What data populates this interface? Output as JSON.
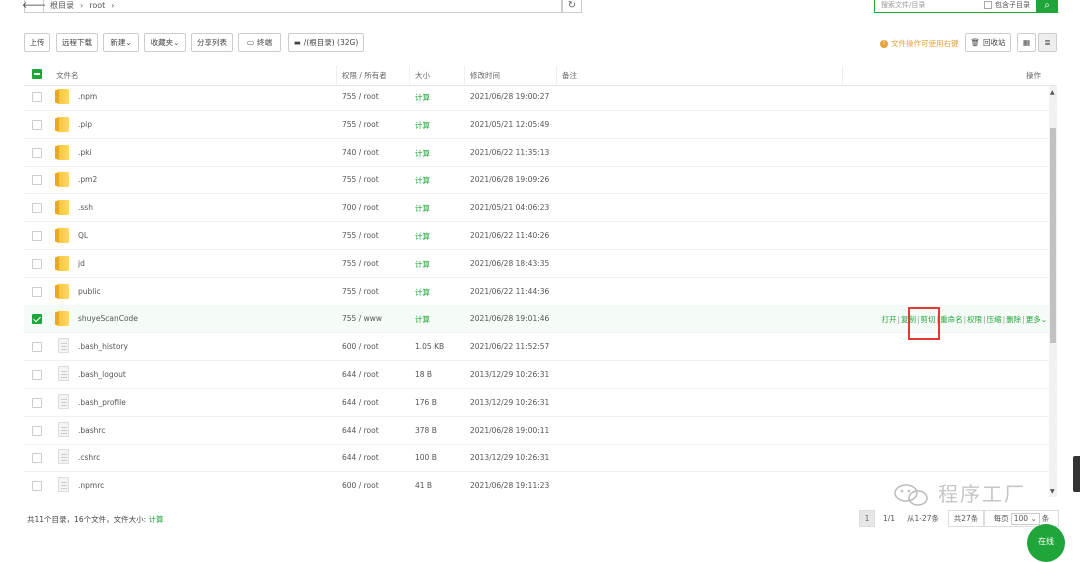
{
  "path": {
    "back_icon": "arrow-left-icon",
    "crumbs": [
      "根目录",
      "root"
    ],
    "refresh_icon": "refresh-icon"
  },
  "search": {
    "placeholder": "搜索文件/目录",
    "include_sub_label": "包含子目录",
    "button_icon": "search-icon"
  },
  "toolbar": {
    "upload": "上传",
    "remote_download": "远程下载",
    "new": "新建",
    "favorites": "收藏夹",
    "share_list": "分享列表",
    "terminal": "终端",
    "disk": "/(根目录) (32G)",
    "warn_text": "文件操作可使用右键",
    "recycle": "回收站"
  },
  "columns": {
    "name": "文件名",
    "perm": "权限 / 所有者",
    "size": "大小",
    "mtime": "修改时间",
    "remark": "备注",
    "ops": "操作"
  },
  "rows": [
    {
      "name": ".npm",
      "type": "folder",
      "perm": "755 / root",
      "size": "计算",
      "mtime": "2021/06/28 19:00:27"
    },
    {
      "name": ".pip",
      "type": "folder",
      "perm": "755 / root",
      "size": "计算",
      "mtime": "2021/05/21 12:05:49"
    },
    {
      "name": ".pki",
      "type": "folder",
      "perm": "740 / root",
      "size": "计算",
      "mtime": "2021/06/22 11:35:13"
    },
    {
      "name": ".pm2",
      "type": "folder",
      "perm": "755 / root",
      "size": "计算",
      "mtime": "2021/06/28 19:09:26"
    },
    {
      "name": ".ssh",
      "type": "folder",
      "perm": "700 / root",
      "size": "计算",
      "mtime": "2021/05/21 04:06:23"
    },
    {
      "name": "QL",
      "type": "folder",
      "perm": "755 / root",
      "size": "计算",
      "mtime": "2021/06/22 11:40:26"
    },
    {
      "name": "jd",
      "type": "folder",
      "perm": "755 / root",
      "size": "计算",
      "mtime": "2021/06/28 18:43:35"
    },
    {
      "name": "public",
      "type": "folder",
      "perm": "755 / root",
      "size": "计算",
      "mtime": "2021/06/22 11:44:36"
    },
    {
      "name": "shuyeScanCode",
      "type": "folder",
      "perm": "755 / www",
      "size": "计算",
      "mtime": "2021/06/28 19:01:46",
      "selected": true
    },
    {
      "name": ".bash_history",
      "type": "file",
      "perm": "600 / root",
      "size": "1.05 KB",
      "mtime": "2021/06/22 11:52:57"
    },
    {
      "name": ".bash_logout",
      "type": "file",
      "perm": "644 / root",
      "size": "18 B",
      "mtime": "2013/12/29 10:26:31"
    },
    {
      "name": ".bash_profile",
      "type": "file",
      "perm": "644 / root",
      "size": "176 B",
      "mtime": "2013/12/29 10:26:31"
    },
    {
      "name": ".bashrc",
      "type": "file",
      "perm": "644 / root",
      "size": "378 B",
      "mtime": "2021/06/28 19:00:11"
    },
    {
      "name": ".cshrc",
      "type": "file",
      "perm": "644 / root",
      "size": "100 B",
      "mtime": "2013/12/29 10:26:31"
    },
    {
      "name": ".npmrc",
      "type": "file",
      "perm": "600 / root",
      "size": "41 B",
      "mtime": "2021/06/28 19:11:23"
    }
  ],
  "row_ops": [
    "打开",
    "复制",
    "剪切",
    "重命名",
    "权限",
    "压缩",
    "删除",
    "更多"
  ],
  "footer": {
    "summary_prefix": "共11个目录，16个文件，文件大小:",
    "summary_calc": "计算",
    "page_current": "1",
    "page_total": "1/1",
    "range": "从1-27条",
    "total": "共27条",
    "per_page_label": "每页",
    "per_page_value": "100",
    "per_page_unit": "条"
  },
  "watermark": "程序工厂",
  "chat_label": "在线",
  "colors": {
    "accent": "#20a53a",
    "warn": "#e6a23c",
    "highlight": "#e53935"
  }
}
